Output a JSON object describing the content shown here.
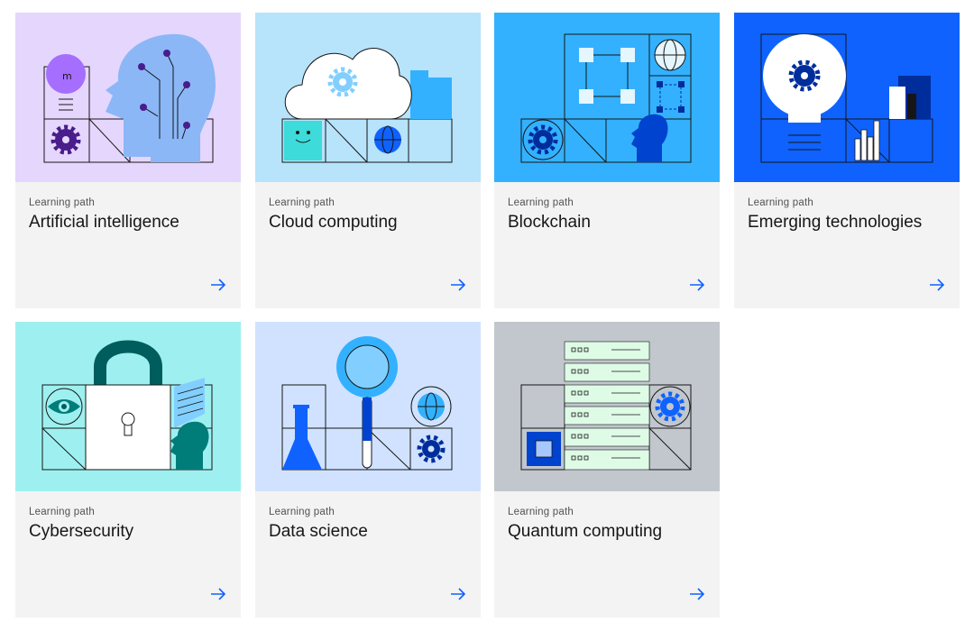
{
  "cards": [
    {
      "kicker": "Learning path",
      "title": "Artificial intelligence",
      "bg": "#e5d6fd",
      "icon": "ai-head-illustration"
    },
    {
      "kicker": "Learning path",
      "title": "Cloud computing",
      "bg": "#b7e3fb",
      "icon": "cloud-illustration"
    },
    {
      "kicker": "Learning path",
      "title": "Blockchain",
      "bg": "#33b1ff",
      "icon": "blockchain-illustration"
    },
    {
      "kicker": "Learning path",
      "title": "Emerging technologies",
      "bg": "#0f62fe",
      "icon": "lightbulb-illustration"
    },
    {
      "kicker": "Learning path",
      "title": "Cybersecurity",
      "bg": "#9ef0f0",
      "icon": "padlock-illustration"
    },
    {
      "kicker": "Learning path",
      "title": "Data science",
      "bg": "#d0e2ff",
      "icon": "magnifier-flask-illustration"
    },
    {
      "kicker": "Learning path",
      "title": "Quantum computing",
      "bg": "#c1c7cd",
      "icon": "server-chip-illustration"
    }
  ],
  "colors": {
    "accent": "#0f62fe",
    "text": "#161616",
    "card_bg": "#f3f3f3"
  }
}
